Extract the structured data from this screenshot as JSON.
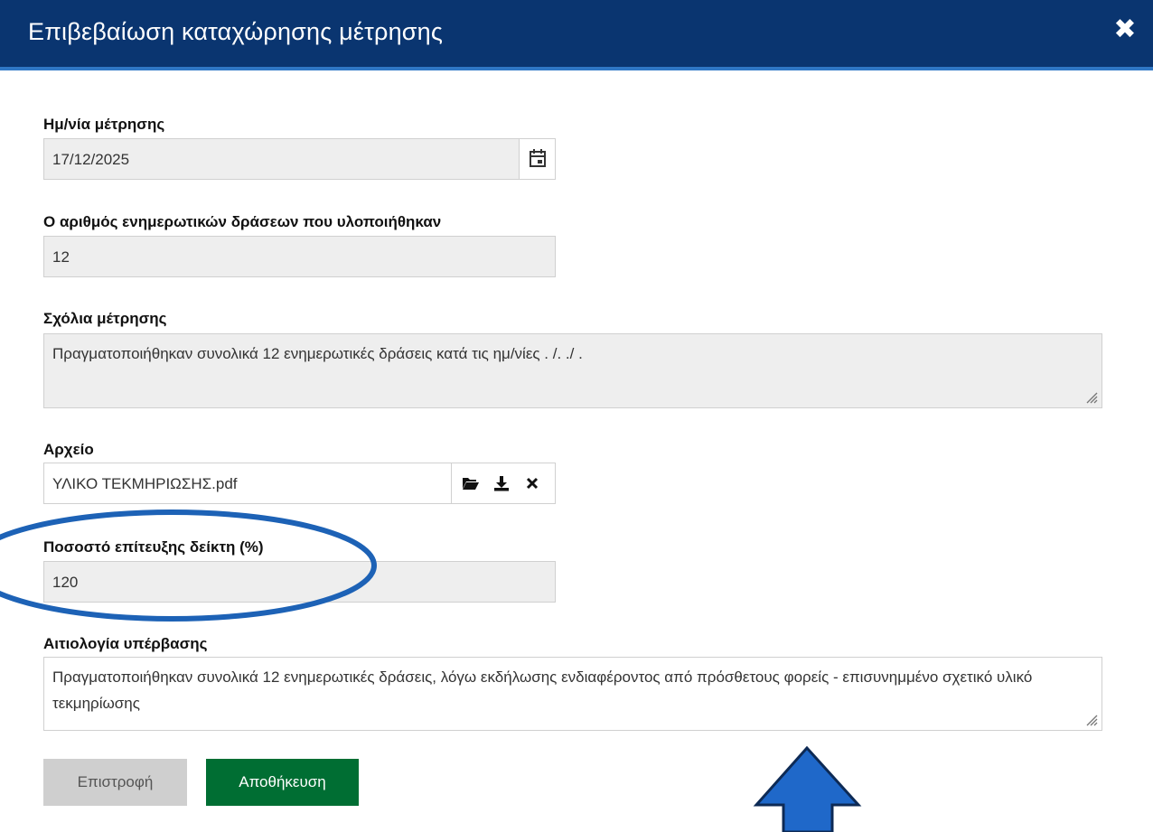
{
  "dialog": {
    "title": "Επιβεβαίωση καταχώρησης μέτρησης",
    "close_icon": "close-icon"
  },
  "fields": {
    "date": {
      "label": "Ημ/νία μέτρησης",
      "value": "17/12/2025",
      "icon": "calendar-icon"
    },
    "actions_count": {
      "label": "Ο αριθμός ενημερωτικών δράσεων που υλοποιήθηκαν",
      "value": "12"
    },
    "comments": {
      "label": "Σχόλια μέτρησης",
      "value": "Πραγματοποιήθηκαν συνολικά 12 ενημερωτικές δράσεις κατά τις ημ/νίες . /. ./ ."
    },
    "file": {
      "label": "Αρχείο",
      "value": "ΥΛΙΚΟ ΤΕΚΜΗΡΙΩΣΗΣ.pdf",
      "icons": [
        "folder-open-icon",
        "download-icon",
        "remove-icon"
      ]
    },
    "achievement": {
      "label": "Ποσοστό επίτευξης δείκτη (%)",
      "value": "120"
    },
    "justification": {
      "label": "Αιτιολογία υπέρβασης",
      "value": "Πραγματοποιήθηκαν συνολικά 12 ενημερωτικές δράσεις, λόγω εκδήλωσης ενδιαφέροντος από πρόσθετους φορείς - επισυνημμένο σχετικό υλικό τεκμηρίωσης"
    }
  },
  "buttons": {
    "back": "Επιστροφή",
    "save": "Αποθήκευση"
  },
  "colors": {
    "header_bg": "#0a3570",
    "header_border": "#2f77c5",
    "save_bg": "#006e33",
    "back_bg": "#cfcfcf",
    "annotation": "#1565c0"
  }
}
